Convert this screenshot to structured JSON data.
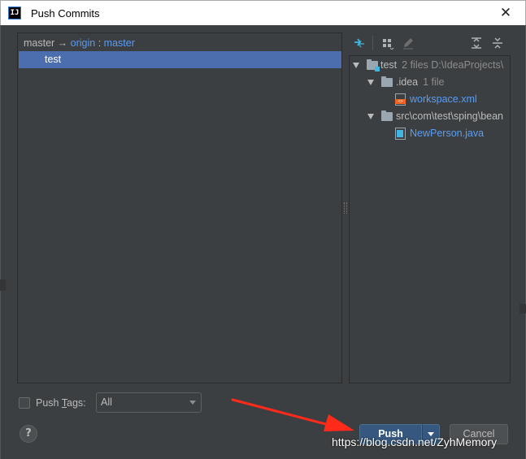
{
  "window": {
    "title": "Push Commits",
    "logo_text": "IJ",
    "close_glyph": "✕"
  },
  "branch": {
    "local": "master",
    "arrow": " → ",
    "remote": "origin",
    "separator": " : ",
    "remote_branch": "master"
  },
  "commits": [
    {
      "message": "test",
      "selected": true
    }
  ],
  "toolbar": {
    "icons": [
      "show-diff-icon",
      "group-by-icon",
      "edit-source-icon",
      "expand-all-icon",
      "collapse-all-icon"
    ]
  },
  "file_tree": {
    "root": {
      "name": "test",
      "meta": "2 files  D:\\IdeaProjects\\"
    },
    "folder1": {
      "name": ".idea",
      "meta": "1 file"
    },
    "file1": {
      "name": "workspace.xml",
      "icon": "xml-file-icon"
    },
    "folder2": {
      "name": "src\\com\\test\\sping\\bean"
    },
    "file2": {
      "name": "NewPerson.java",
      "icon": "java-file-icon"
    }
  },
  "push_tags": {
    "label_prefix": "Push ",
    "label_mnemonic": "T",
    "label_suffix": "ags:",
    "checked": false,
    "selected_option": "All"
  },
  "help": {
    "label": "?"
  },
  "buttons": {
    "push_label": "Push",
    "cancel_label": "Cancel"
  },
  "watermark": "https://blog.csdn.net/ZyhMemory",
  "colors": {
    "background": "#3c3f41",
    "selection": "#4b6eaf",
    "link": "#589df6",
    "primary_button": "#365880",
    "annotation_arrow": "#ff2a1a"
  }
}
